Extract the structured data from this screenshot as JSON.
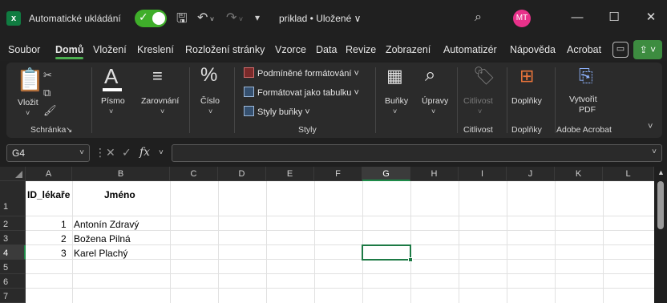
{
  "titlebar": {
    "logo": "x",
    "autosave_label": "Automatické ukládání",
    "filename": "priklad • Uložené ∨",
    "user_initials": "MT",
    "icons": [
      "save-icon",
      "undo-icon",
      "redo-icon",
      "customize-icon",
      "search-icon"
    ]
  },
  "menu": {
    "tabs": [
      "Soubor",
      "Domů",
      "Vložení",
      "Kreslení",
      "Rozložení stránky",
      "Vzorce",
      "Data",
      "Revize",
      "Zobrazení",
      "Automatizér",
      "Nápověda",
      "Acrobat"
    ],
    "active": "Domů"
  },
  "ribbon": {
    "schranka": {
      "paste": "Vložit",
      "group": "Schránka"
    },
    "pismo": {
      "label": "Písmo"
    },
    "zarovnani": {
      "label": "Zarovnání"
    },
    "cislo": {
      "label": "Číslo"
    },
    "styly": {
      "conditional": "Podmíněné formátování ˅",
      "table": "Formátovat jako tabulku ˅",
      "cell_styles": "Styly buňky ˅",
      "group": "Styly"
    },
    "bunky": {
      "label": "Buňky"
    },
    "upravy": {
      "label": "Úpravy"
    },
    "citlivost": {
      "label": "Citlivost",
      "group": "Citlivost"
    },
    "doplnky": {
      "label": "Doplňky",
      "group": "Doplňky"
    },
    "acrobat": {
      "label1": "Vytvořit",
      "label2": "PDF",
      "group": "Adobe Acrobat"
    }
  },
  "formula_bar": {
    "name_box": "G4",
    "fx": "fx",
    "formula": ""
  },
  "grid": {
    "columns": [
      "A",
      "B",
      "C",
      "D",
      "E",
      "F",
      "G",
      "H",
      "I",
      "J",
      "K",
      "L"
    ],
    "rows": [
      "1",
      "2",
      "3",
      "4",
      "5",
      "6",
      "7"
    ],
    "selected_cell": "G4",
    "header": {
      "id": "ID_lékaře",
      "name": "Jméno"
    },
    "data": [
      {
        "id": "1",
        "name": "Antonín Zdravý"
      },
      {
        "id": "2",
        "name": "Božena Pilná"
      },
      {
        "id": "3",
        "name": "Karel Plachý"
      }
    ]
  },
  "colors": {
    "accent": "#107c41",
    "selection": "#1d7a45",
    "toggle_on": "#3fae2a",
    "avatar": "#e8318a"
  }
}
